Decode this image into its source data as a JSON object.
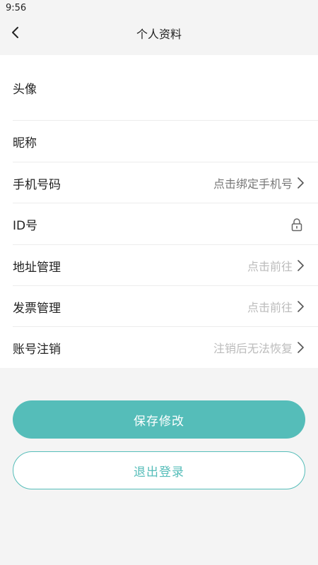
{
  "status_bar": {
    "time": "9:56"
  },
  "header": {
    "title": "个人资料",
    "back_icon": "chevron-left-icon"
  },
  "profile": {
    "rows": [
      {
        "label": "头像",
        "value": "",
        "value_style": "none",
        "icon": ""
      },
      {
        "label": "昵称",
        "value": "",
        "value_style": "none",
        "icon": ""
      },
      {
        "label": "手机号码",
        "value": "点击绑定手机号",
        "value_style": "dark",
        "icon": "chevron-right-icon"
      },
      {
        "label": "ID号",
        "value": "",
        "value_style": "none",
        "icon": "lock-icon"
      },
      {
        "label": "地址管理",
        "value": "点击前往",
        "value_style": "light",
        "icon": "chevron-right-icon"
      },
      {
        "label": "发票管理",
        "value": "点击前往",
        "value_style": "light",
        "icon": "chevron-right-icon"
      },
      {
        "label": "账号注销",
        "value": "注销后无法恢复",
        "value_style": "light",
        "icon": "chevron-right-icon"
      }
    ]
  },
  "actions": {
    "save_label": "保存修改",
    "logout_label": "退出登录"
  },
  "colors": {
    "accent": "#55bdb9",
    "background": "#f4f4f4",
    "card": "#ffffff",
    "value_dark": "#777777",
    "value_light": "#bbbbbb"
  }
}
